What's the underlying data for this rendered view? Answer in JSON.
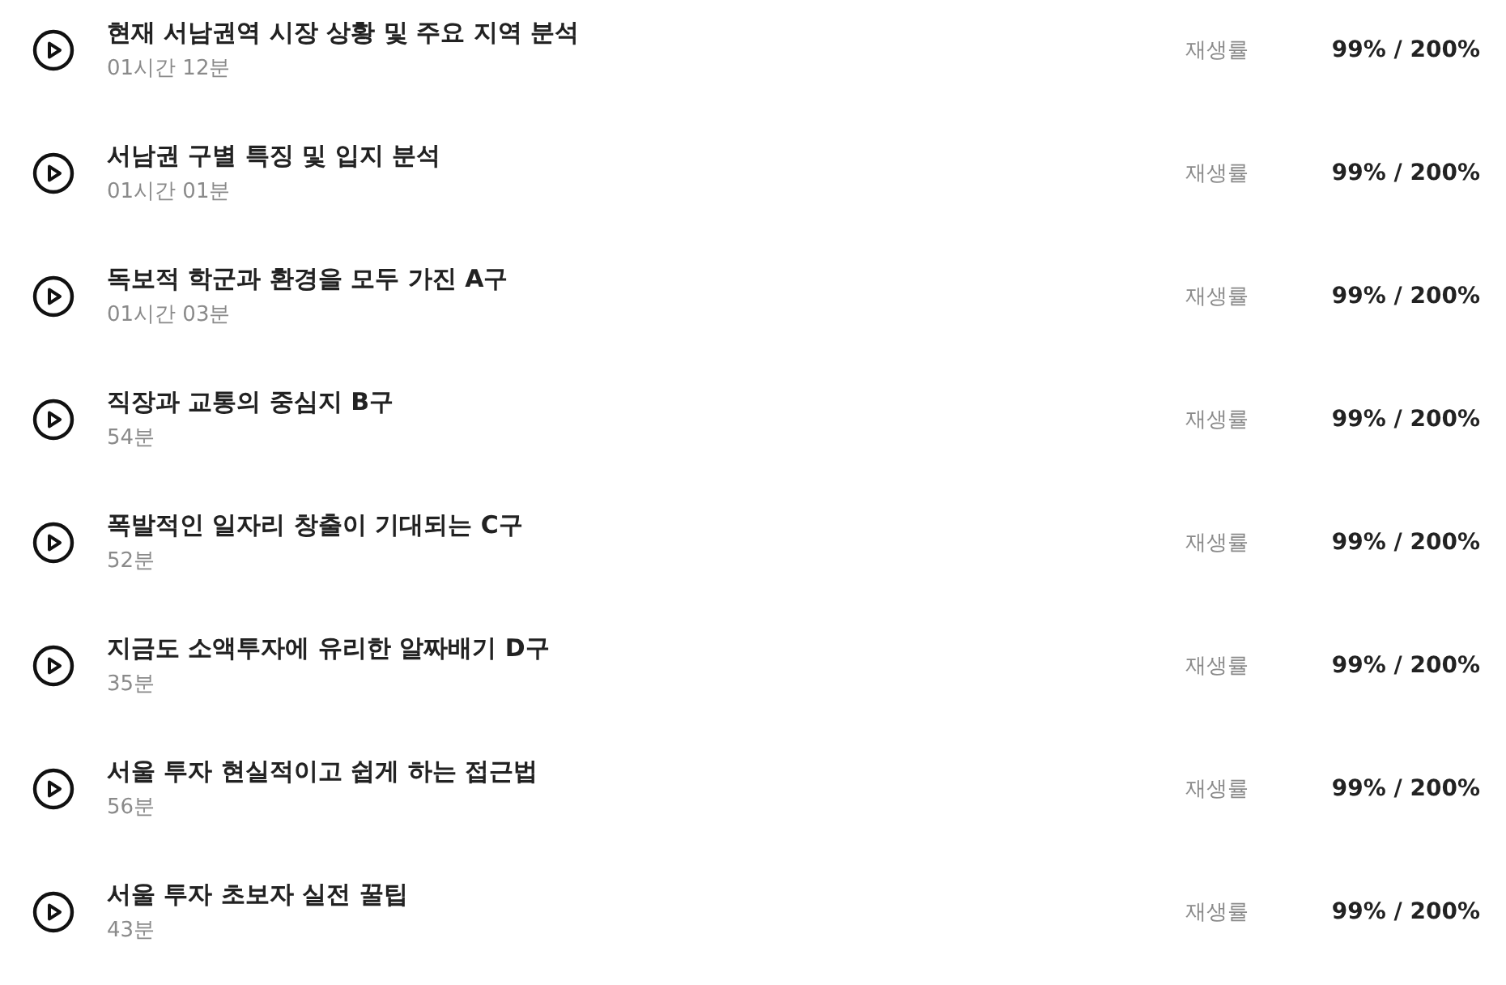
{
  "lessons": [
    {
      "title": "현재 서남권역 시장 상황 및 주요 지역 분석",
      "duration": "01시간 12분",
      "progress_label": "재생률",
      "progress": "99% / 200%"
    },
    {
      "title": "서남권 구별 특징 및 입지 분석",
      "duration": "01시간 01분",
      "progress_label": "재생률",
      "progress": "99% / 200%"
    },
    {
      "title": "독보적 학군과 환경을 모두 가진 A구",
      "duration": "01시간 03분",
      "progress_label": "재생률",
      "progress": "99% / 200%"
    },
    {
      "title": "직장과 교통의 중심지 B구",
      "duration": "54분",
      "progress_label": "재생률",
      "progress": "99% / 200%"
    },
    {
      "title": "폭발적인 일자리 창출이 기대되는 C구",
      "duration": "52분",
      "progress_label": "재생률",
      "progress": "99% / 200%"
    },
    {
      "title": "지금도 소액투자에 유리한 알짜배기 D구",
      "duration": "35분",
      "progress_label": "재생률",
      "progress": "99% / 200%"
    },
    {
      "title": "서울 투자 현실적이고 쉽게 하는 접근법",
      "duration": "56분",
      "progress_label": "재생률",
      "progress": "99% / 200%"
    },
    {
      "title": "서울 투자 초보자 실전 꿀팁",
      "duration": "43분",
      "progress_label": "재생률",
      "progress": "99% / 200%"
    }
  ]
}
